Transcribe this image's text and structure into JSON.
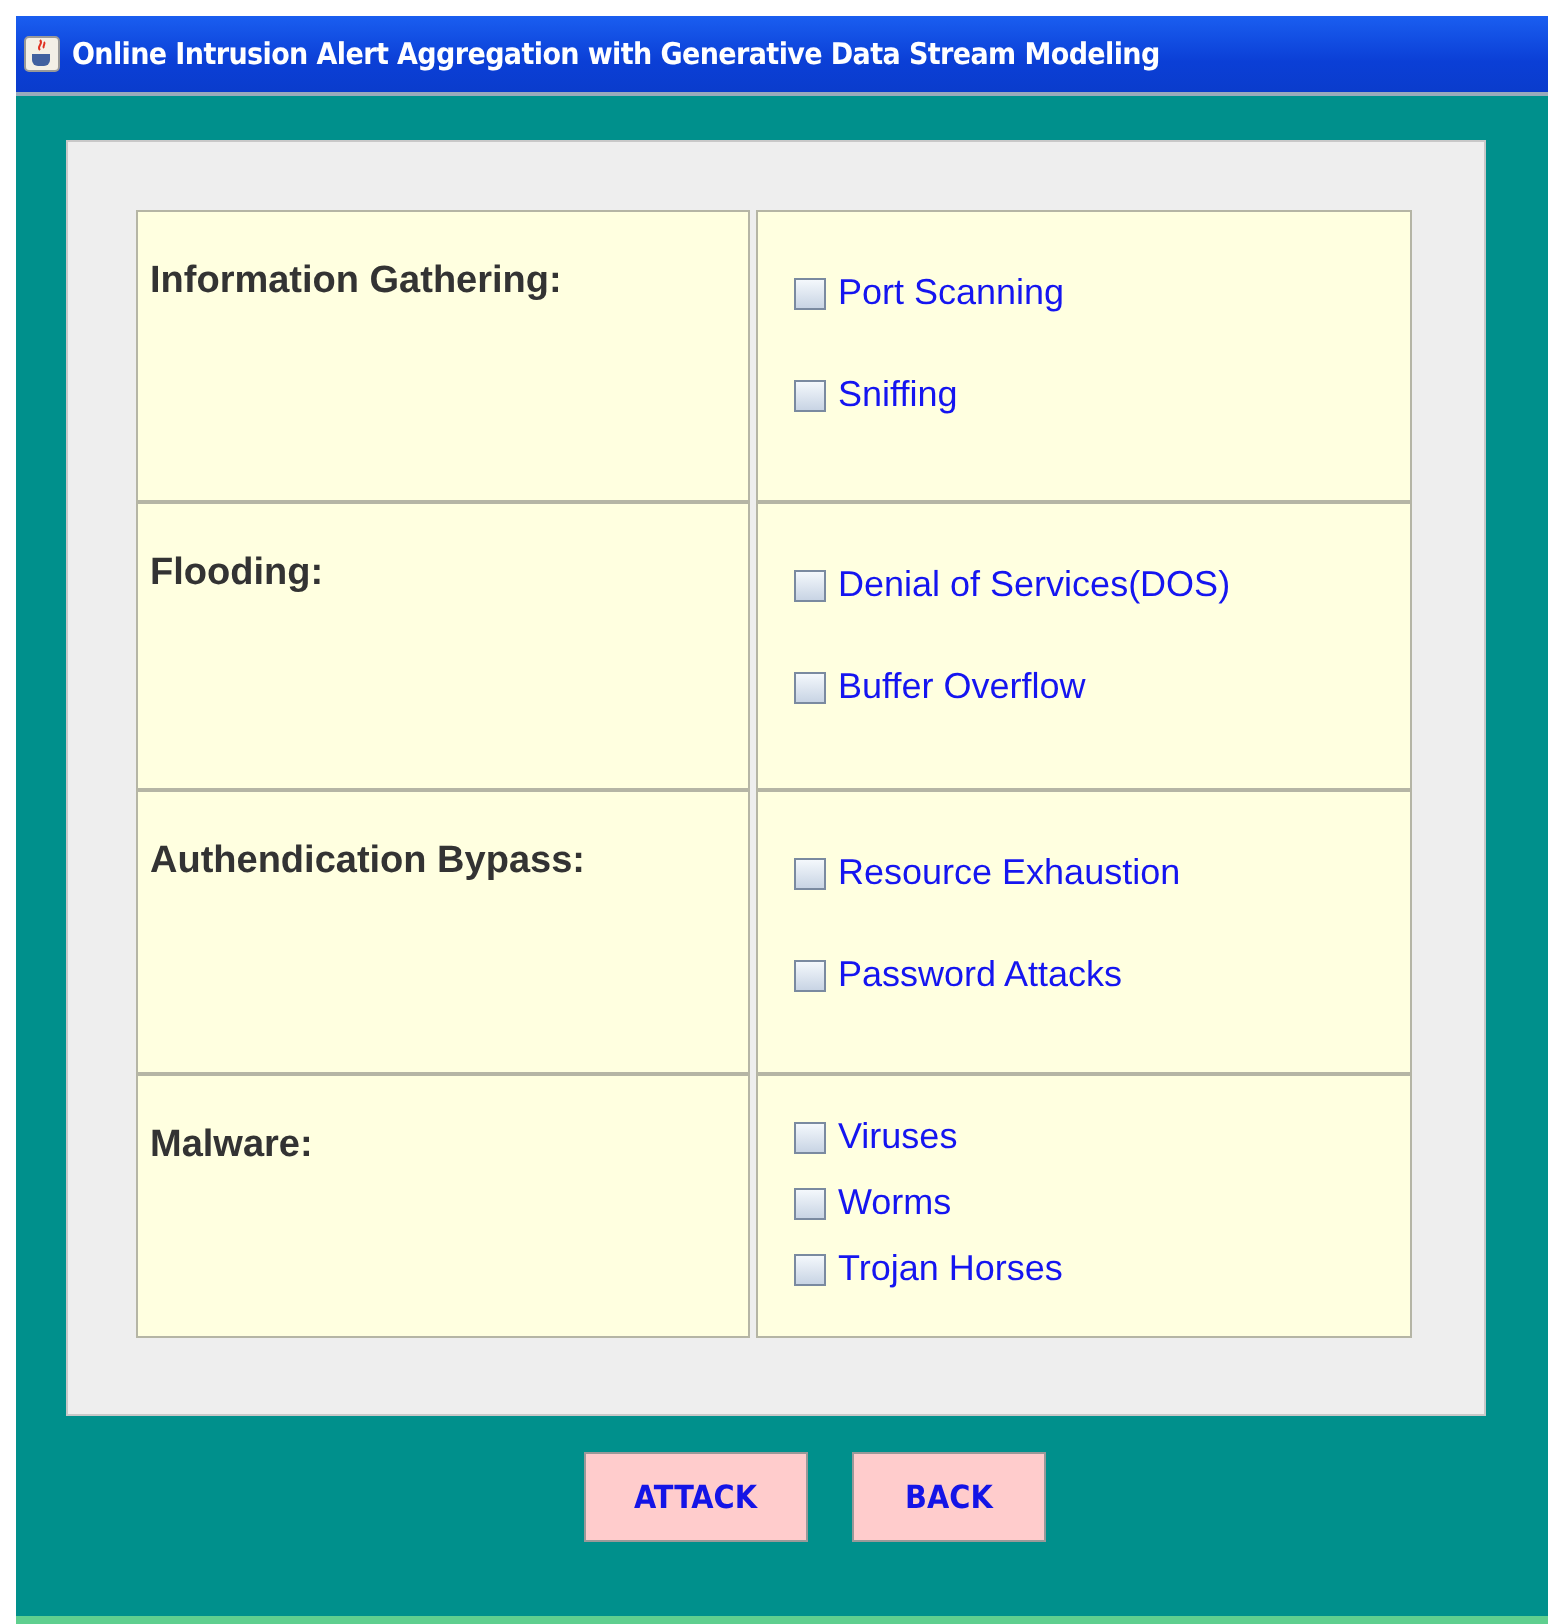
{
  "window": {
    "title": "Online Intrusion Alert Aggregation with Generative Data Stream Modeling"
  },
  "categories": [
    {
      "label": "Information Gathering:",
      "options": [
        {
          "label": "Port Scanning",
          "checked": false
        },
        {
          "label": "Sniffing",
          "checked": false
        }
      ]
    },
    {
      "label": "Flooding:",
      "options": [
        {
          "label": "Denial of Services(DOS)",
          "checked": false
        },
        {
          "label": "Buffer Overflow",
          "checked": false
        }
      ]
    },
    {
      "label": "Authendication Bypass:",
      "options": [
        {
          "label": "Resource Exhaustion",
          "checked": false
        },
        {
          "label": "Password Attacks",
          "checked": false
        }
      ]
    },
    {
      "label": "Malware:",
      "options": [
        {
          "label": "Viruses",
          "checked": false
        },
        {
          "label": "Worms",
          "checked": false
        },
        {
          "label": "Trojan Horses",
          "checked": false
        }
      ]
    }
  ],
  "buttons": [
    "ATTACK",
    "BACK"
  ]
}
